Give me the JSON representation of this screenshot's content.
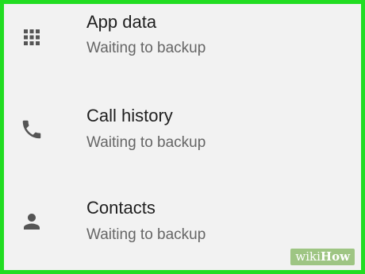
{
  "colors": {
    "frame": "#22dd22",
    "background": "#f2f2f2",
    "icon": "#555555"
  },
  "items": [
    {
      "icon": "apps-grid-icon",
      "title": "App data",
      "status": "Waiting to backup"
    },
    {
      "icon": "phone-icon",
      "title": "Call history",
      "status": "Waiting to backup"
    },
    {
      "icon": "person-icon",
      "title": "Contacts",
      "status": "Waiting to backup"
    }
  ],
  "watermark": {
    "prefix": "wiki",
    "suffix": "How"
  }
}
